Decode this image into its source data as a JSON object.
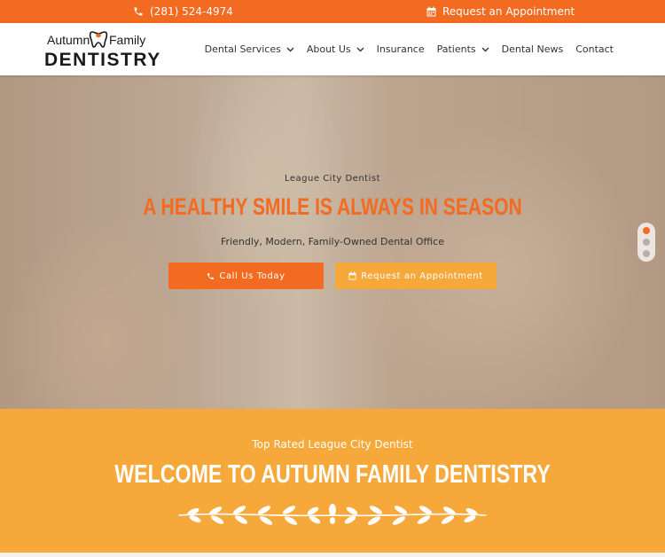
{
  "topbar": {
    "phone": "(281) 524-4974",
    "appointment": "Request an Appointment",
    "bg_color": "#f26b21"
  },
  "logo": {
    "word1": "Autumn",
    "word2": "Family",
    "word3": "DENTISTRY",
    "accent": "#f26b21"
  },
  "nav": {
    "items": [
      {
        "label": "Dental Services",
        "dropdown": true
      },
      {
        "label": "About Us",
        "dropdown": true
      },
      {
        "label": "Insurance",
        "dropdown": false
      },
      {
        "label": "Patients",
        "dropdown": true
      },
      {
        "label": "Dental News",
        "dropdown": false
      },
      {
        "label": "Contact",
        "dropdown": false
      }
    ]
  },
  "hero": {
    "eyebrow": "League City Dentist",
    "title": "A HEALTHY SMILE IS ALWAYS IN SEASON",
    "description": "Friendly, Modern, Family-Owned Dental Office",
    "call_button": "Call Us Today",
    "appointment_button": "Request an Appointment",
    "slides_total": 3,
    "active_slide": 1,
    "title_color": "#f26b21",
    "button_primary_color": "#f26b21",
    "button_secondary_color": "#f6a83a"
  },
  "welcome": {
    "eyebrow": "Top Rated League City Dentist",
    "title": "WELCOME TO AUTUMN FAMILY DENTISTRY",
    "bg_color": "#f6a83a"
  },
  "icons": {
    "phone": "phone-icon",
    "calendar": "calendar-icon",
    "chevron": "chevron-down-icon",
    "ornament": "laurel-divider-icon"
  }
}
